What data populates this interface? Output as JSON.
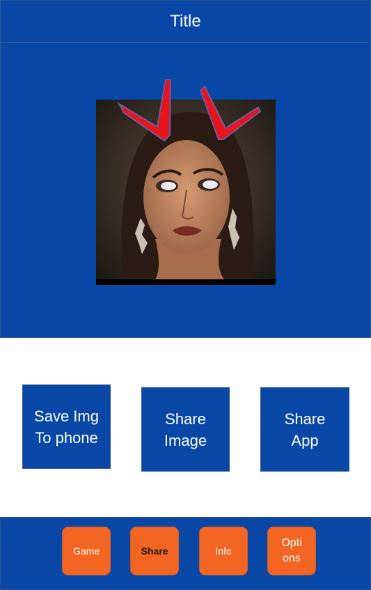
{
  "header": {
    "title": "Title"
  },
  "actions": {
    "save": "Save Img\nTo phone",
    "share_image": "Share\nImage",
    "share_app": "Share\nApp"
  },
  "nav": {
    "game": "Game",
    "share": "Share",
    "info": "Info",
    "options": "Opti\nons"
  },
  "colors": {
    "brand_blue": "#0847a6",
    "nav_orange": "#f26522",
    "horn_red": "#e8141b"
  },
  "image": {
    "subject": "face-with-devil-horns"
  }
}
